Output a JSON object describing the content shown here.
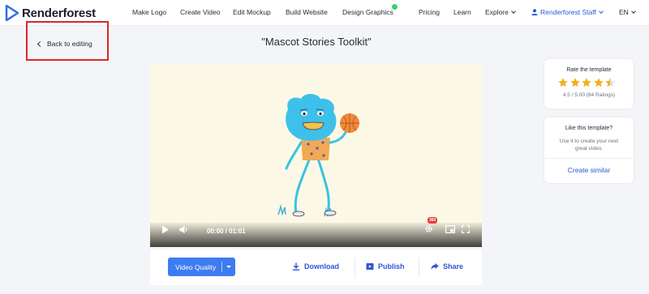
{
  "header": {
    "logo_text": "Renderforest",
    "nav": [
      "Make Logo",
      "Create Video",
      "Edit Mockup",
      "Build Website",
      "Design Graphics",
      "Pricing",
      "Learn",
      "Explore"
    ],
    "user_name": "Renderforest Staff",
    "language": "EN"
  },
  "back_link": "Back to editing",
  "page_title": "\"Mascot Stories Toolkit\"",
  "player": {
    "time": "00:00 / 01:01",
    "hd_badge": "360"
  },
  "actions": {
    "video_quality": "Video Quality",
    "download": "Download",
    "publish": "Publish",
    "share": "Share"
  },
  "rating_card": {
    "title": "Rate the template",
    "score": "4.5 / 5.00",
    "count": "(84 Ratings)",
    "rating_value": 4.5,
    "rating_max": 5
  },
  "like_card": {
    "title": "Like this template?",
    "description": "Use it to create your next great video.",
    "create_similar": "Create similar"
  },
  "colors": {
    "accent": "#3d7cf0",
    "link": "#2f56d6",
    "highlight_box": "#d42a2a",
    "star": "#f2b01e"
  }
}
